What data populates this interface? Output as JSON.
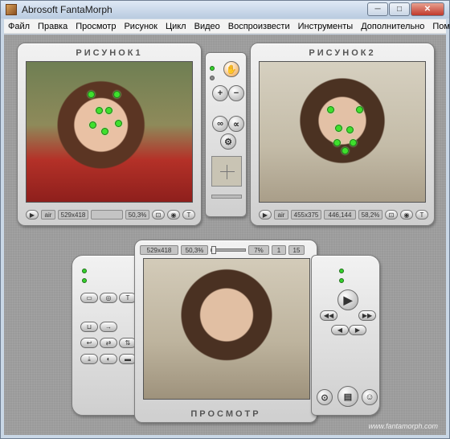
{
  "window": {
    "title": "Abrosoft FantaMorph",
    "minimize": "─",
    "maximize": "□",
    "close": "✕"
  },
  "menu": [
    "Файл",
    "Правка",
    "Просмотр",
    "Рисунок",
    "Цикл",
    "Видео",
    "Воспроизвести",
    "Инструменты",
    "Дополнительно",
    "Помощь"
  ],
  "image1": {
    "title": "РИСУНОК1",
    "ratio": "air",
    "size": "529x418",
    "coord": "",
    "zoom": "50,3%"
  },
  "image2": {
    "title": "РИСУНОК2",
    "ratio": "air",
    "size": "455x375",
    "coord": "446,144",
    "zoom": "58,2%"
  },
  "preview": {
    "title": "ПРОСМОТР",
    "size": "529x418",
    "zoom": "50,3%",
    "percent": "7%",
    "frame": "1",
    "total": "15"
  },
  "center_controls": {
    "hand": "✋",
    "plus": "+",
    "minus": "−",
    "link1": "∞",
    "link2": "∝",
    "extra": "⚙"
  },
  "preview_controls": {
    "play": "▶",
    "prev": "◀◀",
    "next": "▶▶",
    "back": "◀",
    "fwd": "▶",
    "text": "T"
  },
  "footer": {
    "url": "www.fantamorph.com"
  },
  "colors": {
    "accent_green": "#35d12c",
    "panel": "#e3e3e3",
    "bg": "#9a9a9a"
  }
}
